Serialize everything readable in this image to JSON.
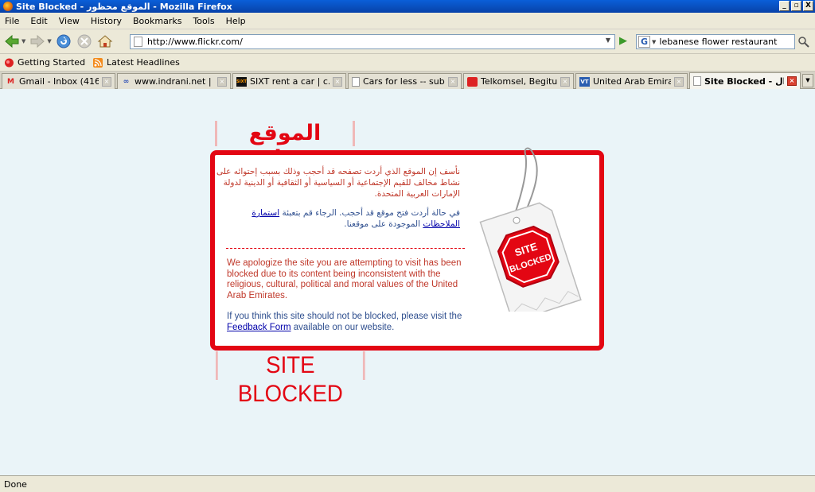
{
  "window": {
    "title": "Site Blocked - الموقع محظور - Mozilla Firefox",
    "min": "_",
    "max": "▫",
    "close": "X"
  },
  "menu": [
    "File",
    "Edit",
    "View",
    "History",
    "Bookmarks",
    "Tools",
    "Help"
  ],
  "navigation": {
    "url": "http://www.flickr.com/",
    "search_value": "lebanese flower restaurant",
    "search_engine": "G"
  },
  "bookmarks": [
    {
      "label": "Getting Started",
      "icon": "firefox-icon"
    },
    {
      "label": "Latest Headlines",
      "icon": "rss-icon"
    }
  ],
  "tabs": [
    {
      "label": "Gmail - Inbox (416)",
      "icon": "gmail-icon",
      "icon_text": "M"
    },
    {
      "label": "www.indrani.net | i...",
      "icon": "infinity-icon",
      "icon_text": "∞"
    },
    {
      "label": "SIXT rent a car | c...",
      "icon": "sixt-icon",
      "icon_text": "SIXT"
    },
    {
      "label": "Cars for less -- sub...",
      "icon": "page-icon",
      "icon_text": ""
    },
    {
      "label": "Telkomsel, Begitu D...",
      "icon": "telkomsel-icon",
      "icon_text": ""
    },
    {
      "label": "United Arab Emirat...",
      "icon": "vt-icon",
      "icon_text": "VT"
    },
    {
      "label": "Site Blocked - ال...",
      "icon": "page-icon",
      "icon_text": ""
    }
  ],
  "content": {
    "heading_ar": "الموقع محظور",
    "ar_para1": "نأسف إن الموقع الذي أردت تصفحه قد أحجب وذلك بسبب إحتوائه على نشاط مخالف للقيم الإجتماعية أو السياسية أو الثقافية أو الدينية لدولة الإمارات العربية المتحدة.",
    "ar_para2_pre": "في حالة أردت فتح موقع قد أحجب. الرجاء قم بتعبئة",
    "ar_para2_link": "استمارة الملاحظات",
    "ar_para2_post": "الموجودة على موقعنا.",
    "divider": "-----------------------------------------------------------------------",
    "en_para1": "We apologize the site you are attempting to visit has been blocked due to its content being inconsistent with the religious, cultural, political and moral values of the United Arab Emirates.",
    "en_para2_pre": "If you think this site should not be blocked, please visit the",
    "en_para2_link": "Feedback Form",
    "en_para2_post": "available on our website.",
    "heading_en": "SITE BLOCKED",
    "tag_text_line1": "SITE",
    "tag_text_line2": "BLOCKED"
  },
  "status": "Done",
  "colors": {
    "brand_red": "#e30613",
    "page_bg": "#eaf4f8",
    "link_blue": "#0000aa"
  }
}
